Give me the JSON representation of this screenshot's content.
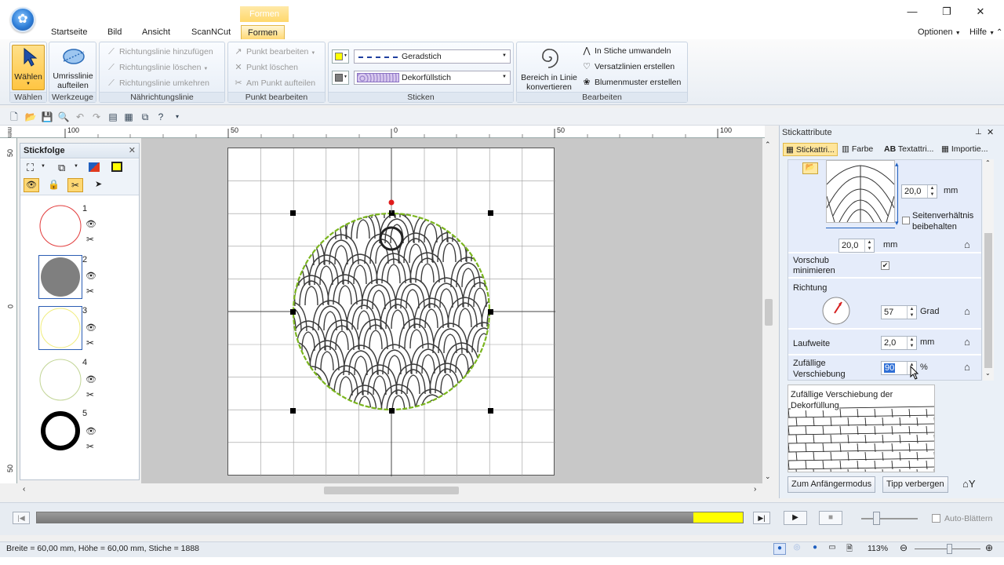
{
  "app": {
    "logo_glyph": "✿"
  },
  "ribbon_context_tab": "Formen",
  "window_controls": {
    "minimize": "—",
    "maximize": "❐",
    "close": "✕"
  },
  "menu_tabs": [
    "Startseite",
    "Bild",
    "Ansicht",
    "ScanNCut",
    "Formen"
  ],
  "menu_right": {
    "options": "Optionen",
    "help": "Hilfe"
  },
  "ribbon": {
    "select": {
      "label_line1": "Wählen",
      "group": "Wählen"
    },
    "tools": {
      "label_line1": "Umrisslinie",
      "label_line2": "aufteilen",
      "group": "Werkzeuge"
    },
    "direction": {
      "items": [
        "Richtungslinie hinzufügen",
        "Richtungslinie löschen",
        "Richtungslinie umkehren"
      ],
      "group": "Nährichtungslinie"
    },
    "points": {
      "items": [
        "Punkt bearbeiten",
        "Punkt löschen",
        "Am Punkt aufteilen"
      ],
      "group": "Punkt bearbeiten"
    },
    "stitch": {
      "line_stitch": "Geradstich",
      "fill_stitch": "Dekorfüllstich",
      "group": "Sticken"
    },
    "edit": {
      "convert_line1": "Bereich in Linie",
      "convert_line2": "konvertieren",
      "items": [
        "In Stiche umwandeln",
        "Versatzlinien erstellen",
        "Blumenmuster erstellen"
      ],
      "group": "Bearbeiten"
    }
  },
  "rulers": {
    "top": [
      "100",
      "50",
      "0",
      "50",
      "100"
    ],
    "left": [
      "mm",
      "50",
      "0",
      "50"
    ]
  },
  "stickfolge": {
    "title": "Stickfolge",
    "items": [
      {
        "num": "1",
        "kind": "red-outline-circle"
      },
      {
        "num": "2",
        "kind": "gray-filled-circle"
      },
      {
        "num": "3",
        "kind": "yellow-outline-circle"
      },
      {
        "num": "4",
        "kind": "green-outline-circle"
      },
      {
        "num": "5",
        "kind": "black-thick-ring"
      }
    ]
  },
  "right_panel": {
    "title": "Stickattribute",
    "tabs": [
      "Stickattri...",
      "Farbe",
      "Textattri...",
      "Importie..."
    ],
    "height_value": "20,0",
    "width_value": "20,0",
    "unit_mm": "mm",
    "aspect_line1": "Seitenverhältnis",
    "aspect_line2": "beibehalten",
    "feed_line1": "Vorschub",
    "feed_line2": "minimieren",
    "feed_checked": "✔",
    "direction_label": "Richtung",
    "direction_value": "57",
    "direction_unit": "Grad",
    "run_pitch_label": "Laufweite",
    "run_pitch_value": "2,0",
    "random_line1": "Zufällige",
    "random_line2": "Verschiebung",
    "random_value": "90",
    "random_unit": "%",
    "tip_line1": "Zufällige Verschiebung der",
    "tip_line2": "Dekorfüllung",
    "btn_beginner": "Zum Anfängermodus",
    "btn_hide_tip": "Tipp verbergen"
  },
  "simulator": {
    "auto_scroll": "Auto-Blättern",
    "progress": 0.93
  },
  "status": {
    "text": "Breite = 60,00 mm, Höhe = 60,00 mm, Stiche = 1888",
    "zoom": "113%"
  },
  "colors": {
    "accent": "#ffd874",
    "selection_green": "#7ab51d",
    "progress_yellow": "#ffff00"
  }
}
